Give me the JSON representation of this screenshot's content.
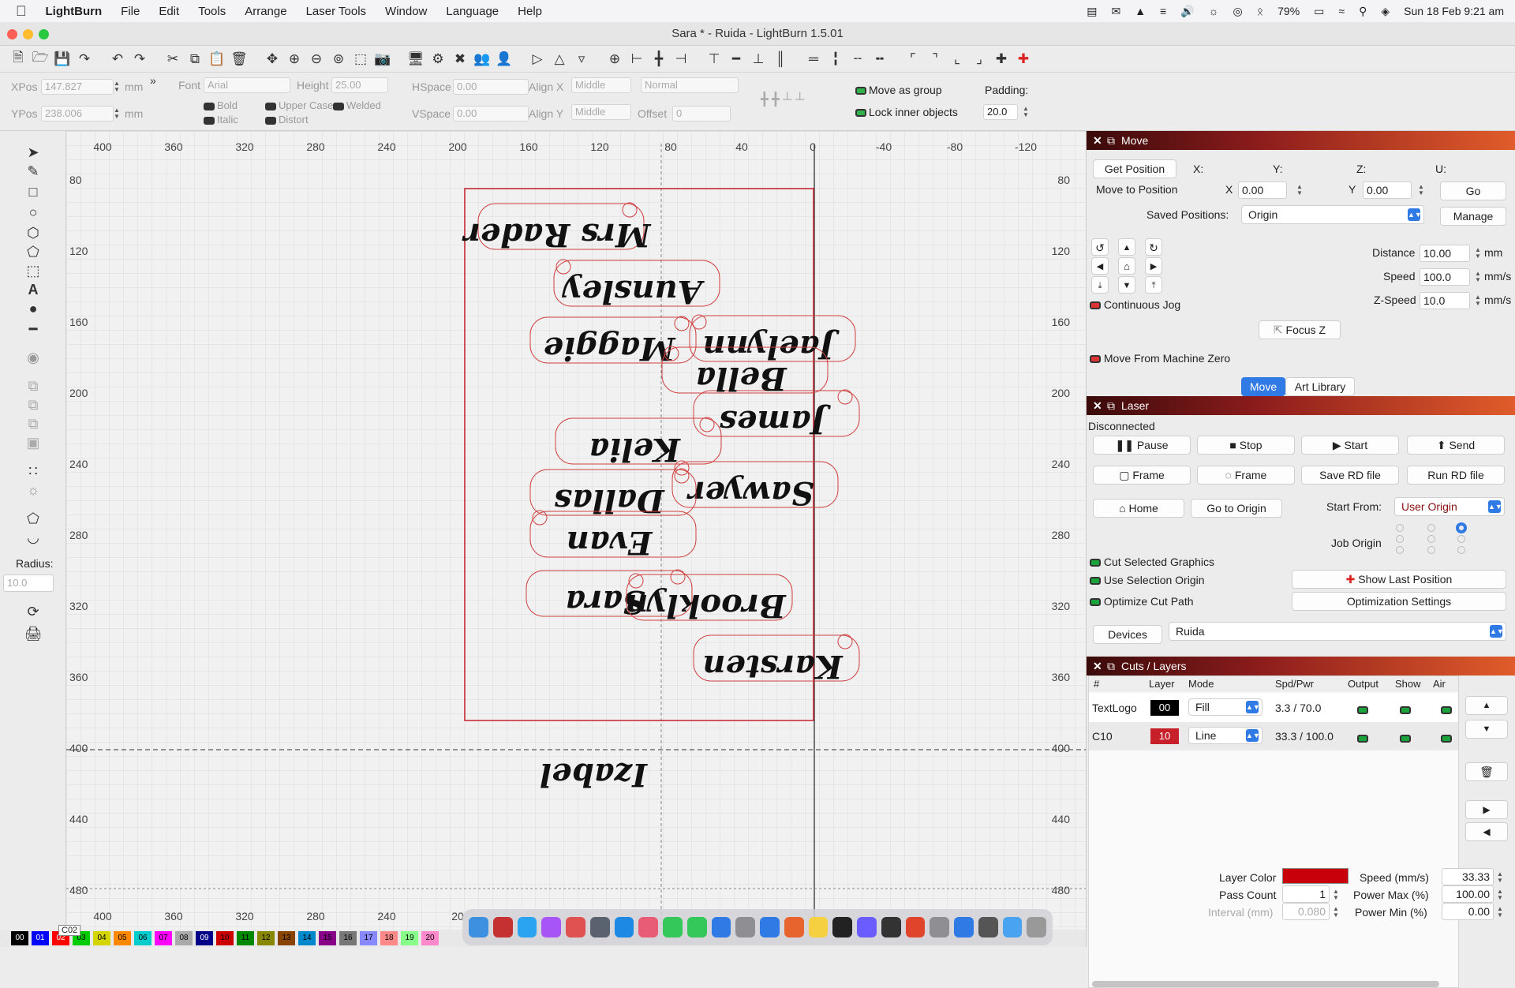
{
  "menubar": {
    "app": "LightBurn",
    "items": [
      "File",
      "Edit",
      "Tools",
      "Arrange",
      "Laser Tools",
      "Window",
      "Language",
      "Help"
    ],
    "battery": "79%",
    "datetime": "Sun 18 Feb  9:21 am"
  },
  "window": {
    "title": "Sara * - Ruida - LightBurn 1.5.01"
  },
  "props": {
    "xpos_label": "XPos",
    "xpos": "147.827",
    "ypos_label": "YPos",
    "ypos": "238.006",
    "unit": "mm",
    "font_label": "Font",
    "font": "Arial",
    "height_label": "Height",
    "height": "25.00",
    "bold": "Bold",
    "italic": "Italic",
    "upper_case": "Upper Case",
    "welded": "Welded",
    "distort": "Distort",
    "hspace_label": "HSpace",
    "hspace": "0.00",
    "vspace_label": "VSpace",
    "vspace": "0.00",
    "alignx_label": "Align X",
    "alignx": "Middle",
    "aligny_label": "Align Y",
    "aligny": "Middle",
    "style": "Normal",
    "offset_label": "Offset",
    "offset": "0",
    "move_as_group": "Move as group",
    "lock_inner": "Lock inner objects",
    "padding_label": "Padding:",
    "padding": "20.0"
  },
  "lefttools": {
    "radius_label": "Radius:",
    "radius": "10.0"
  },
  "rulers": {
    "top": [
      "400",
      "360",
      "320",
      "280",
      "240",
      "200",
      "160",
      "120",
      "80",
      "40",
      "0",
      "-40",
      "-80",
      "-120"
    ],
    "left": [
      "80",
      "120",
      "160",
      "200",
      "240",
      "280",
      "320",
      "360",
      "400",
      "440",
      "480"
    ],
    "bottom": [
      "400",
      "360",
      "320",
      "280",
      "240",
      "20"
    ]
  },
  "canvas": {
    "names": [
      "Mrs Rader",
      "Aunsley",
      "Maggie",
      "Jaelynn",
      "James",
      "Bella",
      "Kelia",
      "Sawyer",
      "Dallas",
      "Evan",
      "Sara",
      "Brooklyn",
      "Karsten",
      "Izabel"
    ],
    "tooltip": "C02"
  },
  "move": {
    "title": "Move",
    "get_position": "Get Position",
    "x": "X:",
    "y": "Y:",
    "z": "Z:",
    "u": "U:",
    "move_to_position": "Move to Position",
    "mx_label": "X",
    "mx": "0.00",
    "my_label": "Y",
    "my": "0.00",
    "go": "Go",
    "saved_label": "Saved Positions:",
    "saved": "Origin",
    "manage": "Manage",
    "distance_label": "Distance",
    "distance": "10.00",
    "speed_label": "Speed",
    "speed": "100.0",
    "zspeed_label": "Z-Speed",
    "zspeed": "10.0",
    "unit_mm": "mm",
    "unit_mms": "mm/s",
    "continuous_jog": "Continuous Jog",
    "focus_z": "Focus Z",
    "move_from_zero": "Move From Machine Zero",
    "tab_move": "Move",
    "tab_art": "Art Library"
  },
  "laser": {
    "title": "Laser",
    "status": "Disconnected",
    "pause": "Pause",
    "stop": "Stop",
    "start": "Start",
    "send": "Send",
    "frame1": "Frame",
    "frame2": "Frame",
    "save_rd": "Save RD file",
    "run_rd": "Run RD file",
    "home": "Home",
    "go_origin": "Go to Origin",
    "start_from_label": "Start From:",
    "start_from": "User Origin",
    "job_origin": "Job Origin",
    "cut_selected": "Cut Selected Graphics",
    "use_selection_origin": "Use Selection Origin",
    "optimize_cut": "Optimize Cut Path",
    "show_last": "Show Last Position",
    "opt_settings": "Optimization Settings",
    "devices": "Devices",
    "device": "Ruida"
  },
  "cuts": {
    "title": "Cuts / Layers",
    "headers": [
      "#",
      "Layer",
      "Mode",
      "Spd/Pwr",
      "Output",
      "Show",
      "Air"
    ],
    "rows": [
      {
        "name": "TextLogo",
        "layer": "00",
        "mode": "Fill",
        "spdpwr": "3.3 / 70.0",
        "color": "#000000"
      },
      {
        "name": "C10",
        "layer": "10",
        "mode": "Line",
        "spdpwr": "33.3 / 100.0",
        "color": "#c8202a"
      }
    ],
    "layer_color_label": "Layer Color",
    "speed_label": "Speed (mm/s)",
    "speed": "33.33",
    "pass_label": "Pass Count",
    "pass": "1",
    "powmax_label": "Power Max (%)",
    "powmax": "100.00",
    "interval_label": "Interval (mm)",
    "interval": "0.080",
    "powmin_label": "Power Min (%)",
    "powmin": "0.00",
    "layer_color": "#c8000a"
  },
  "palette": [
    "00",
    "01",
    "02",
    "03",
    "04",
    "05",
    "06",
    "07",
    "08",
    "09",
    "10",
    "11",
    "12",
    "13",
    "14",
    "15",
    "16",
    "17",
    "18",
    "19",
    "20"
  ],
  "palette_colors": [
    "#000000",
    "#0000ff",
    "#ff0000",
    "#00cc00",
    "#d4d400",
    "#ff8800",
    "#00cccc",
    "#ff00ff",
    "#aaaaaa",
    "#000088",
    "#cc0000",
    "#008800",
    "#888800",
    "#884400",
    "#0088cc",
    "#880088",
    "#777777",
    "#8888ff",
    "#ff8888",
    "#88ff88",
    "#ff88cc"
  ]
}
